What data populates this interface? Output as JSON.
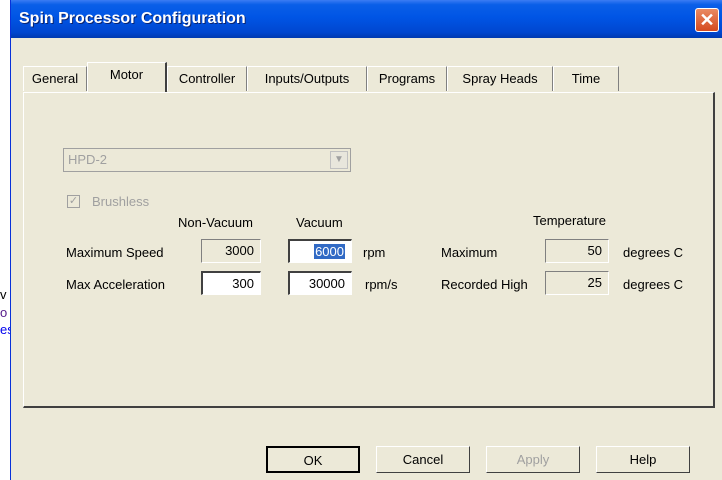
{
  "background_text": [
    "v",
    "o",
    "es"
  ],
  "window": {
    "title": "Spin Processor Configuration",
    "close": "✕"
  },
  "tabs": [
    "General",
    "Motor",
    "Controller",
    "Inputs/Outputs",
    "Programs",
    "Spray Heads",
    "Time"
  ],
  "active_tab": "Motor",
  "motor": {
    "model": "HPD-2",
    "brushless_label": "Brushless",
    "brushless_checked": true,
    "col_nonvacuum": "Non-Vacuum",
    "col_vacuum": "Vacuum",
    "col_temperature": "Temperature",
    "rows": [
      {
        "label": "Maximum Speed",
        "nonvacuum": "3000",
        "vacuum": "6000",
        "unit": "rpm"
      },
      {
        "label": "Max Acceleration",
        "nonvacuum": "300",
        "vacuum": "30000",
        "unit": "rpm/s"
      }
    ],
    "temperature": [
      {
        "label": "Maximum",
        "value": "50",
        "unit": "degrees C"
      },
      {
        "label": "Recorded High",
        "value": "25",
        "unit": "degrees C"
      }
    ]
  },
  "buttons": {
    "ok": "OK",
    "cancel": "Cancel",
    "apply": "Apply",
    "help": "Help"
  }
}
